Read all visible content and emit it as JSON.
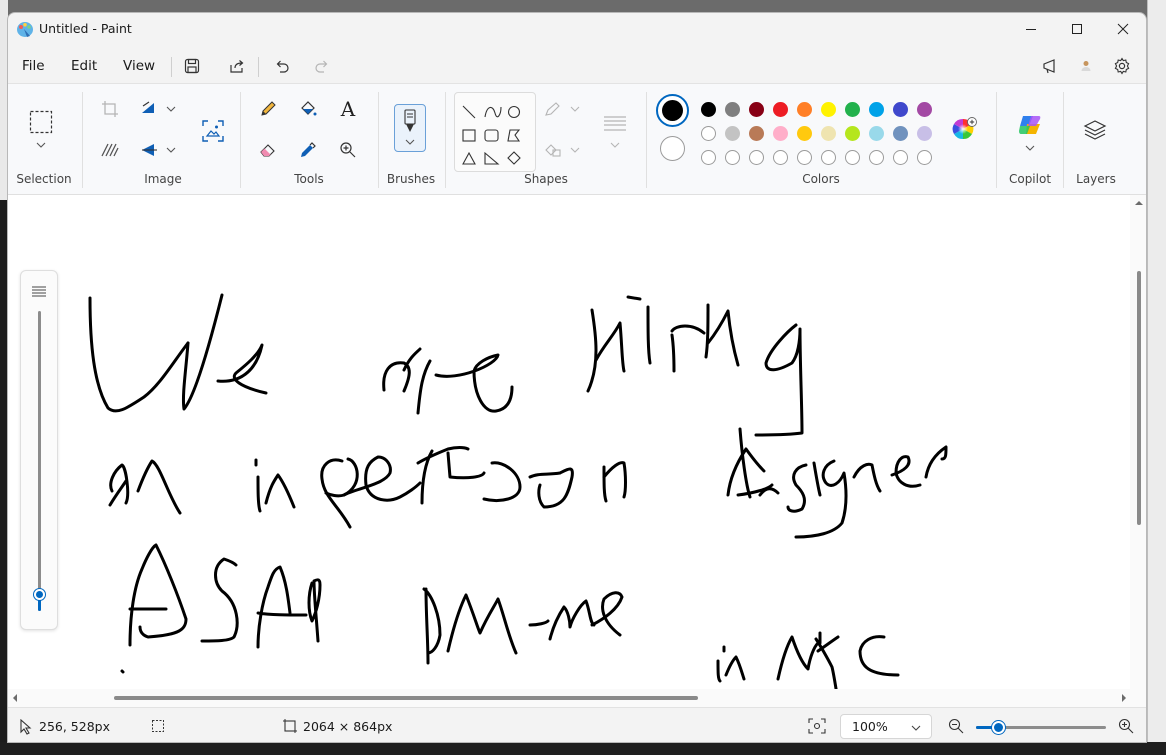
{
  "window": {
    "title": "Untitled - Paint"
  },
  "menu": {
    "file": "File",
    "edit": "Edit",
    "view": "View"
  },
  "ribbon": {
    "groups": {
      "selection": "Selection",
      "image": "Image",
      "tools": "Tools",
      "brushes": "Brushes",
      "shapes": "Shapes",
      "colors": "Colors",
      "copilot": "Copilot",
      "layers": "Layers"
    },
    "primary_color": "#000000",
    "secondary_color": "#ffffff",
    "palette_row1": [
      "#000000",
      "#7f7f7f",
      "#880015",
      "#ed1c24",
      "#ff7f27",
      "#fff200",
      "#22b14c",
      "#00a2e8",
      "#3f48cc",
      "#a349a4"
    ],
    "palette_row2": [
      "#ffffff",
      "#c3c3c3",
      "#b97a57",
      "#ffaec9",
      "#ffc90e",
      "#efe4b0",
      "#b5e61d",
      "#99d9ea",
      "#7092be",
      "#c8bfe7"
    ],
    "palette_row3_count": 10,
    "text_tool_glyph": "A"
  },
  "status": {
    "cursor_position": "256, 528px",
    "canvas_size": "2064 × 864px",
    "zoom": "100%"
  },
  "brush_size_level": 0.05,
  "accent_color": "#0067c0"
}
